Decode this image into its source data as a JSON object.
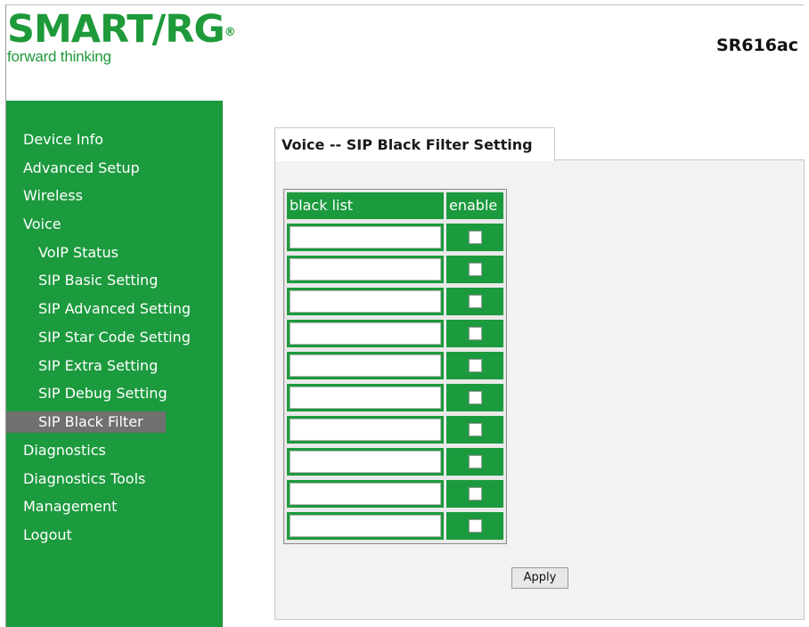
{
  "brand": {
    "name": "SMART/RG",
    "registered": "®",
    "tagline": "forward thinking",
    "model": "SR616ac"
  },
  "nav": [
    {
      "label": "Device Info",
      "level": 0,
      "active": false
    },
    {
      "label": "Advanced Setup",
      "level": 0,
      "active": false
    },
    {
      "label": "Wireless",
      "level": 0,
      "active": false
    },
    {
      "label": "Voice",
      "level": 0,
      "active": false
    },
    {
      "label": "VoIP Status",
      "level": 1,
      "active": false
    },
    {
      "label": "SIP Basic Setting",
      "level": 1,
      "active": false
    },
    {
      "label": "SIP Advanced Setting",
      "level": 1,
      "active": false
    },
    {
      "label": "SIP Star Code Setting",
      "level": 1,
      "active": false
    },
    {
      "label": "SIP Extra Setting",
      "level": 1,
      "active": false
    },
    {
      "label": "SIP Debug Setting",
      "level": 1,
      "active": false
    },
    {
      "label": "SIP Black Filter",
      "level": 1,
      "active": true
    },
    {
      "label": "Diagnostics",
      "level": 0,
      "active": false
    },
    {
      "label": "Diagnostics Tools",
      "level": 0,
      "active": false
    },
    {
      "label": "Management",
      "level": 0,
      "active": false
    },
    {
      "label": "Logout",
      "level": 0,
      "active": false
    }
  ],
  "page": {
    "tab_title": "Voice -- SIP Black Filter Setting"
  },
  "table": {
    "columns": [
      "black list",
      "enable"
    ],
    "rows": [
      {
        "value": "",
        "enabled": false
      },
      {
        "value": "",
        "enabled": false
      },
      {
        "value": "",
        "enabled": false
      },
      {
        "value": "",
        "enabled": false
      },
      {
        "value": "",
        "enabled": false
      },
      {
        "value": "",
        "enabled": false
      },
      {
        "value": "",
        "enabled": false
      },
      {
        "value": "",
        "enabled": false
      },
      {
        "value": "",
        "enabled": false
      },
      {
        "value": "",
        "enabled": false
      }
    ]
  },
  "actions": {
    "apply_label": "Apply"
  },
  "colors": {
    "brand_green": "#1c9a3e",
    "active_nav": "#707070"
  }
}
